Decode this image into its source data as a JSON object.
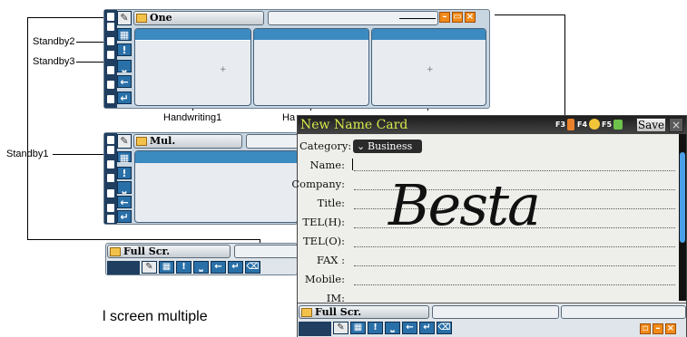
{
  "panels": {
    "one": {
      "tab": "One"
    },
    "mul": {
      "tab": "Mul."
    },
    "full": {
      "tab": "Full Scr."
    }
  },
  "callouts": {
    "standby1": "Standby1",
    "standby2": "Standby2",
    "standby3": "Standby3",
    "handwriting1": "Handwriting1",
    "handwriting_partial": "Ha"
  },
  "caption": "l screen multiple",
  "card": {
    "title": "New Name Card",
    "f3": "F3",
    "f4": "F4",
    "f5": "F5",
    "save": "Save",
    "close": "×",
    "category_label": "Category:",
    "category_value": "Business",
    "fields": [
      {
        "label": "Name:"
      },
      {
        "label": "Company:"
      },
      {
        "label": "Title:"
      },
      {
        "label": "TEL(H):"
      },
      {
        "label": "TEL(O):"
      },
      {
        "label": "FAX :"
      },
      {
        "label": "Mobile:"
      },
      {
        "label": "IM:"
      }
    ],
    "handwriting_ink": "Besta",
    "bottom_tab": "Full Scr."
  },
  "colors": {
    "ime_blue": "#3b8ac0",
    "title_yellow": "#d7e84a",
    "orange": "#f08a1a"
  }
}
